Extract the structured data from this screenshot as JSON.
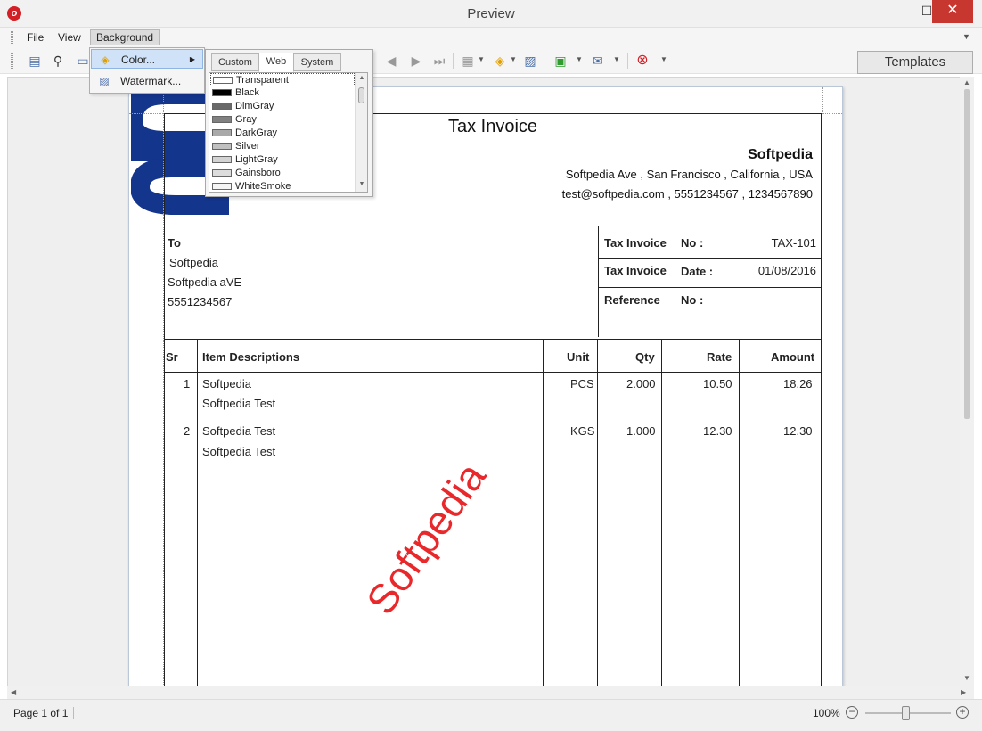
{
  "window": {
    "title": "Preview",
    "minimize": "—",
    "maximize": "☐",
    "close": "✕"
  },
  "menubar": {
    "file": "File",
    "view": "View",
    "background": "Background"
  },
  "toolbar": {
    "templates": "Templates"
  },
  "background_menu": {
    "items": [
      {
        "label": "Color...",
        "icon": "paint-bucket-icon"
      },
      {
        "label": "Watermark...",
        "icon": "watermark-icon"
      }
    ]
  },
  "color_popup": {
    "tabs": [
      "Custom",
      "Web",
      "System"
    ],
    "active_tab": "Web",
    "colors": [
      {
        "name": "Transparent",
        "hex": "#ffffff"
      },
      {
        "name": "Black",
        "hex": "#000000"
      },
      {
        "name": "DimGray",
        "hex": "#696969"
      },
      {
        "name": "Gray",
        "hex": "#808080"
      },
      {
        "name": "DarkGray",
        "hex": "#a9a9a9"
      },
      {
        "name": "Silver",
        "hex": "#c0c0c0"
      },
      {
        "name": "LightGray",
        "hex": "#d3d3d3"
      },
      {
        "name": "Gainsboro",
        "hex": "#dcdcdc"
      },
      {
        "name": "WhiteSmoke",
        "hex": "#f5f5f5"
      }
    ]
  },
  "invoice": {
    "title": "Tax Invoice",
    "company": {
      "name": "Softpedia",
      "address": "Softpedia Ave , San Francisco , California , USA",
      "contact": "test@softpedia.com , 5551234567 , 1234567890"
    },
    "to": {
      "label": "To",
      "lines": [
        "Softpedia",
        "Softpedia aVE",
        "5551234567"
      ]
    },
    "meta": [
      {
        "label": "Tax Invoice",
        "key": "No :",
        "value": "TAX-101"
      },
      {
        "label": "Tax Invoice",
        "key": "Date :",
        "value": "01/08/2016"
      },
      {
        "label": "Reference",
        "key": "No :",
        "value": ""
      }
    ],
    "columns": [
      "Sr",
      "Item Descriptions",
      "Unit",
      "Qty",
      "Rate",
      "Amount"
    ],
    "rows": [
      {
        "sr": "1",
        "desc": "Softpedia",
        "desc2": "Softpedia Test",
        "unit": "PCS",
        "qty": "2.000",
        "rate": "10.50",
        "amount": "18.26"
      },
      {
        "sr": "2",
        "desc": "Softpedia Test",
        "desc2": "Softpedia Test",
        "unit": "KGS",
        "qty": "1.000",
        "rate": "12.30",
        "amount": "12.30"
      }
    ],
    "watermark": "Softpedia"
  },
  "status": {
    "page": "Page 1 of 1",
    "zoom": "100%",
    "zoom_minus": "−",
    "zoom_plus": "+"
  },
  "colors": {
    "accent": "#d31f26",
    "watermark": "#e8282b",
    "logo": "#14358c",
    "highlight": "#cfe2f7"
  }
}
